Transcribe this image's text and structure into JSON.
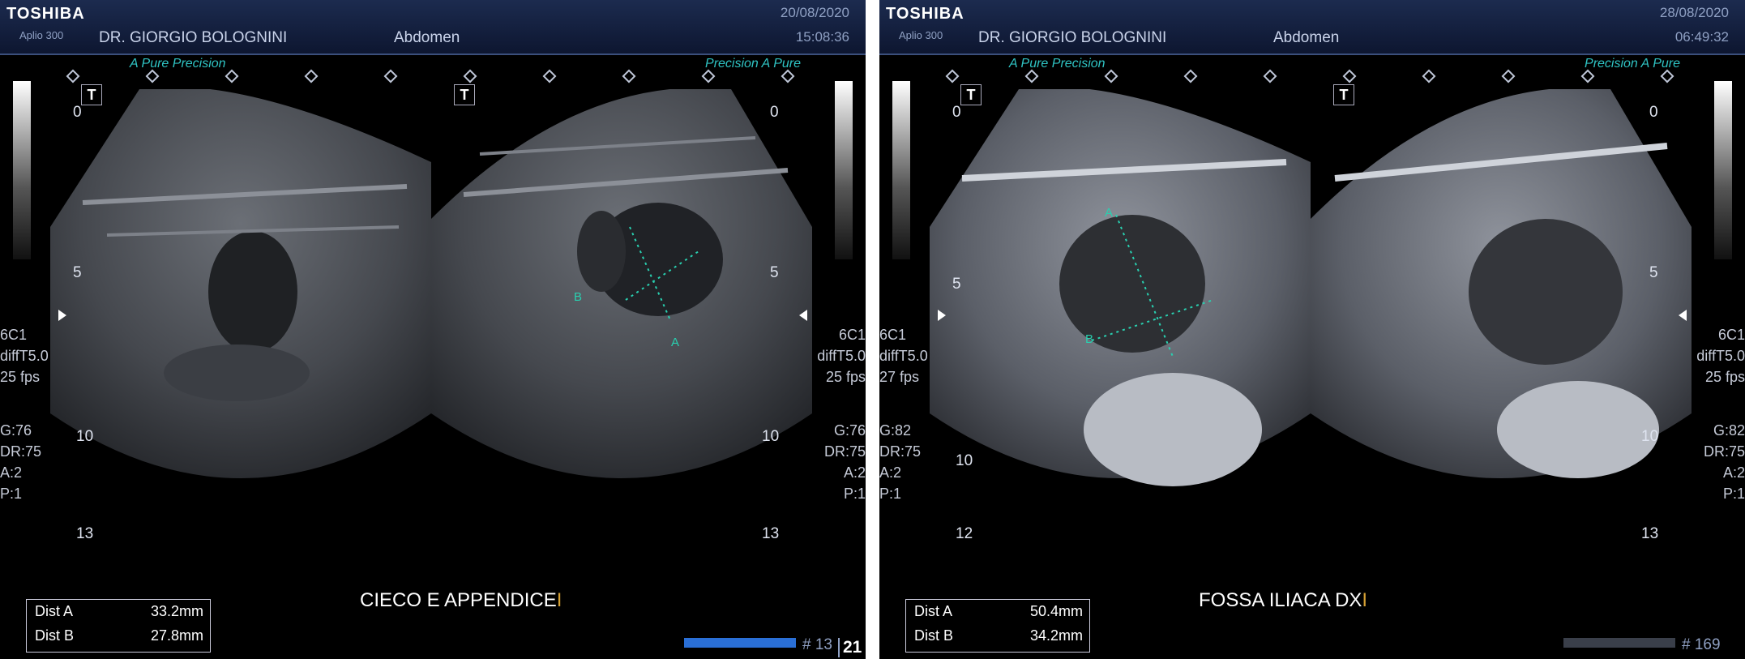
{
  "panels": [
    {
      "brand": "TOSHIBA",
      "model": "Aplio 300",
      "doctor": "DR. GIORGIO BOLOGNINI",
      "exam": "Abdomen",
      "date": "20/08/2020",
      "time": "15:08:36",
      "mode_left": "A Pure Precision",
      "mode_right": "Precision A Pure",
      "depth_left": [
        "0",
        "5",
        "10",
        "13"
      ],
      "depth_right": [
        "0",
        "5",
        "10",
        "13"
      ],
      "params_left": [
        "6C1",
        "diffT5.0",
        "25 fps",
        "G:76",
        "DR:75",
        "A:2",
        "P:1"
      ],
      "params_right": [
        "6C1",
        "diffT5.0",
        "25 fps",
        "G:76",
        "DR:75",
        "A:2",
        "P:1"
      ],
      "measurements": [
        {
          "label": "Dist A",
          "value": "33.2mm"
        },
        {
          "label": "Dist B",
          "value": "27.8mm"
        }
      ],
      "annotation": "CIECO E APPENDICE",
      "cursor": "I",
      "frame_label": "# 13",
      "frame_number": "21",
      "cine_progress": 1.0,
      "markers": [
        "A",
        "B"
      ]
    },
    {
      "brand": "TOSHIBA",
      "model": "Aplio 300",
      "doctor": "DR. GIORGIO BOLOGNINI",
      "exam": "Abdomen",
      "date": "28/08/2020",
      "time": "06:49:32",
      "mode_left": "A Pure Precision",
      "mode_right": "Precision A Pure",
      "depth_left": [
        "0",
        "5",
        "10",
        "12"
      ],
      "depth_right": [
        "0",
        "5",
        "10",
        "13"
      ],
      "params_left": [
        "6C1",
        "diffT5.0",
        "27 fps",
        "G:82",
        "DR:75",
        "A:2",
        "P:1"
      ],
      "params_right": [
        "6C1",
        "diffT5.0",
        "25 fps",
        "G:82",
        "DR:75",
        "A:2",
        "P:1"
      ],
      "measurements": [
        {
          "label": "Dist A",
          "value": "50.4mm"
        },
        {
          "label": "Dist B",
          "value": "34.2mm"
        }
      ],
      "annotation": "FOSSA ILIACA DX",
      "cursor": "I",
      "frame_label": "# 169",
      "cine_progress": 1.0,
      "markers": [
        "A",
        "B"
      ]
    }
  ],
  "colors": {
    "header_bg": "#152243",
    "accent_cyan": "#2fc3c3",
    "cine_bar_active": "#2a6fd6",
    "cine_bar_inactive": "#3a3f4a",
    "cursor": "#d5a033"
  }
}
